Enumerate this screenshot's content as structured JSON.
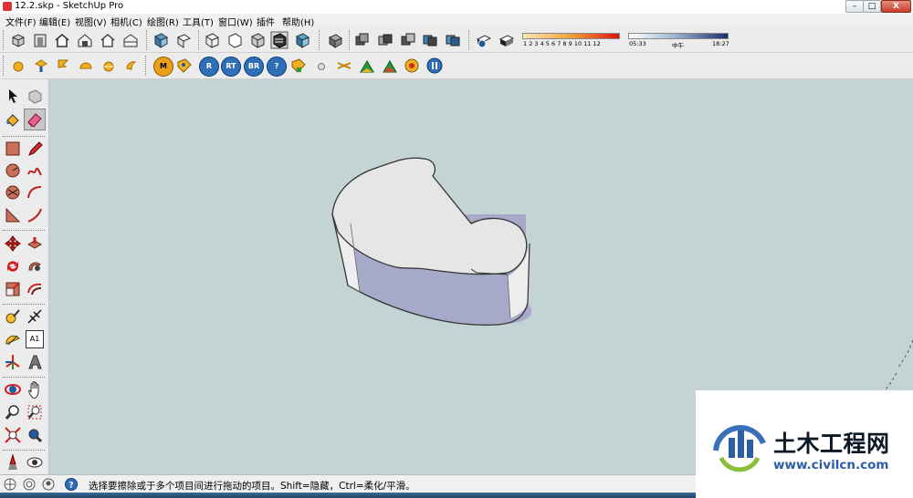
{
  "window": {
    "title": "12.2.skp - SketchUp Pro",
    "min_glyph": "–",
    "max_glyph": "□",
    "close_glyph": "X"
  },
  "menu": [
    {
      "id": "file",
      "label": "文件(F)"
    },
    {
      "id": "edit",
      "label": "编辑(E)"
    },
    {
      "id": "view",
      "label": "视图(V)"
    },
    {
      "id": "camera",
      "label": "相机(C)"
    },
    {
      "id": "draw",
      "label": "绘图(R)"
    },
    {
      "id": "tools",
      "label": "工具(T)"
    },
    {
      "id": "window",
      "label": "窗口(W)"
    },
    {
      "id": "plugins",
      "label": "插件"
    },
    {
      "id": "help",
      "label": "帮助(H)"
    }
  ],
  "toolbar_plugins": {
    "m_label": "M",
    "r_label": "R",
    "rt_label": "RT",
    "br_label": "BR",
    "help_label": "?"
  },
  "shadow": {
    "month_ticks": "1 2 3 4 5 6 7 8 9 10 11 12",
    "time_start": "05:33",
    "time_noon": "中午",
    "time_end": "18:27"
  },
  "left_toolbar": {
    "text_tool_label": "A1"
  },
  "status": {
    "message": "选择要擦除或于多个项目间进行拖动的项目。Shift=隐藏，Ctrl=柔化/平滑。"
  },
  "watermark": {
    "name": "土木工程网",
    "url": "www.civilcn.com"
  },
  "colors": {
    "viewport_background": "#c4d4d4",
    "model_top_face": "#e6e6e6",
    "model_front_face": "#a7a9c8",
    "model_side_face": "#eeeeee",
    "watermark_url": "#2d5da5"
  }
}
